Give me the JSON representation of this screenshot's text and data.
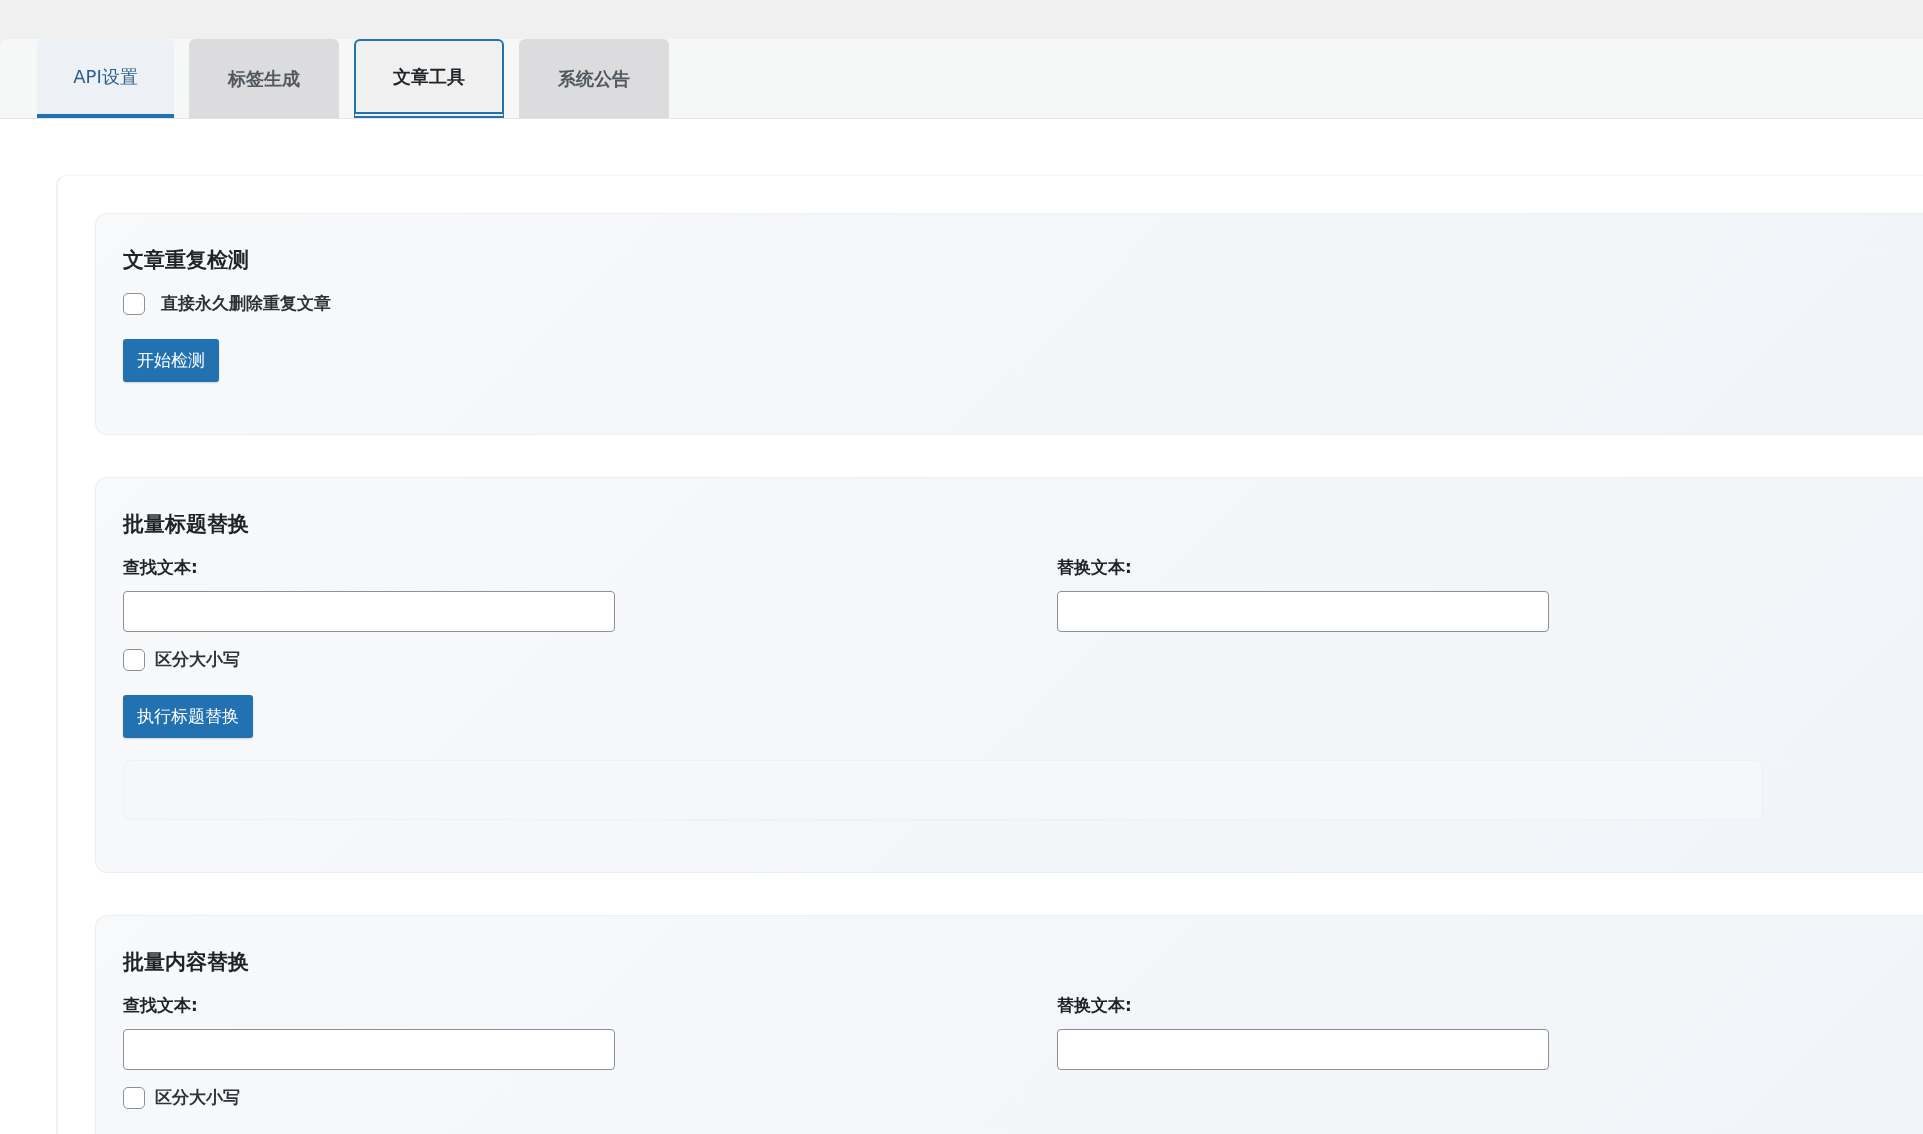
{
  "tabs": [
    {
      "label": "API设置",
      "selected": false,
      "underlined": true
    },
    {
      "label": "标签生成",
      "selected": false,
      "underlined": false
    },
    {
      "label": "文章工具",
      "selected": true,
      "underlined": false
    },
    {
      "label": "系统公告",
      "selected": false,
      "underlined": false
    }
  ],
  "sections": [
    {
      "title": "文章重复检测",
      "options": [
        {
          "label": "直接永久删除重复文章",
          "checked": false
        }
      ],
      "button": "开始检测"
    },
    {
      "title": "批量标题替换",
      "fields": [
        {
          "label": "查找文本:"
        },
        {
          "label": "替换文本:"
        }
      ],
      "options": [
        {
          "label": "区分大小写",
          "checked": false
        }
      ],
      "button": "执行标题替换",
      "result_panel": true
    },
    {
      "title": "批量内容替换",
      "fields": [
        {
          "label": "查找文本:"
        },
        {
          "label": "替换文本:"
        }
      ],
      "options": [
        {
          "label": "区分大小写",
          "checked": false
        }
      ]
    }
  ]
}
